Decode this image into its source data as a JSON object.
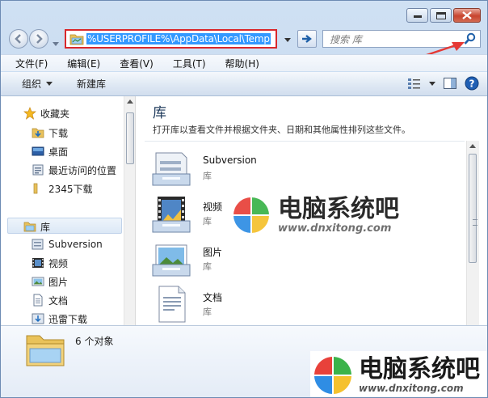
{
  "address": {
    "path": "%USERPROFILE%\\AppData\\Local\\Temp"
  },
  "search": {
    "placeholder": "搜索 库"
  },
  "menu": [
    "文件(F)",
    "编辑(E)",
    "查看(V)",
    "工具(T)",
    "帮助(H)"
  ],
  "toolbar": {
    "organize": "组织",
    "new_library": "新建库"
  },
  "nav": {
    "favorites": "收藏夹",
    "downloads": "下载",
    "desktop": "桌面",
    "recent": "最近访问的位置",
    "dl2345": "2345下载",
    "libraries": "库",
    "subversion": "Subversion",
    "videos": "视频",
    "pictures": "图片",
    "documents": "文档",
    "xunlei": "迅雷下载"
  },
  "content": {
    "title": "库",
    "description": "打开库以查看文件并根据文件夹、日期和其他属性排列这些文件。",
    "items": [
      {
        "name": "Subversion",
        "type": "库"
      },
      {
        "name": "视频",
        "type": "库"
      },
      {
        "name": "图片",
        "type": "库"
      },
      {
        "name": "文档",
        "type": "库"
      }
    ]
  },
  "status": {
    "count": "6 个对象"
  },
  "watermark": {
    "brand": "电脑系统吧",
    "url": "www.dnxitong.com"
  },
  "colors": {
    "highlight_box": "#d9282b",
    "selection": "#3399ff",
    "arrow": "#e53935"
  }
}
